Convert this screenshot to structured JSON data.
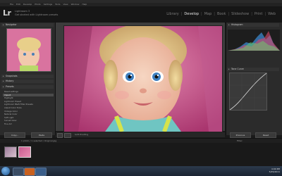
{
  "menu": [
    "File",
    "Edit",
    "Develop",
    "Photo",
    "Settings",
    "Tools",
    "View",
    "Window",
    "Help"
  ],
  "identity": {
    "logo": "Lr",
    "name": "Lightroom 3",
    "subtitle": "Get started with Lightroom presets"
  },
  "modules": [
    "Library",
    "Develop",
    "Map",
    "Book",
    "Slideshow",
    "Print",
    "Web"
  ],
  "active_module": "Develop",
  "left_panel": {
    "navigator": "Navigator",
    "snapshots": "Snapshots",
    "history": "History",
    "presets_header": "Presets",
    "presets": [
      "Reset settings",
      "Import",
      "Highlight",
      "Lightroom Preset",
      "Lightroom B&W Filter Presets",
      "Adjust Color Tools",
      "Vintage Color",
      "Natural Color",
      "Soft Light",
      "Sunset Glow",
      "Fine Art"
    ],
    "copy_label": "Copy...",
    "paste_label": "Paste"
  },
  "toolbar": {
    "soft_proofing": "Soft Proofing"
  },
  "right_panel": {
    "histogram": "Histogram",
    "tone_curve": "Tone Curve",
    "previous_label": "Previous",
    "reset_label": "Reset"
  },
  "filmstrip": {
    "info": "1 photo / 1 selected / Original.jpg",
    "filter": "Filter:"
  },
  "taskbar": {
    "time": "4:00 PM",
    "date": "5/25/2011"
  }
}
